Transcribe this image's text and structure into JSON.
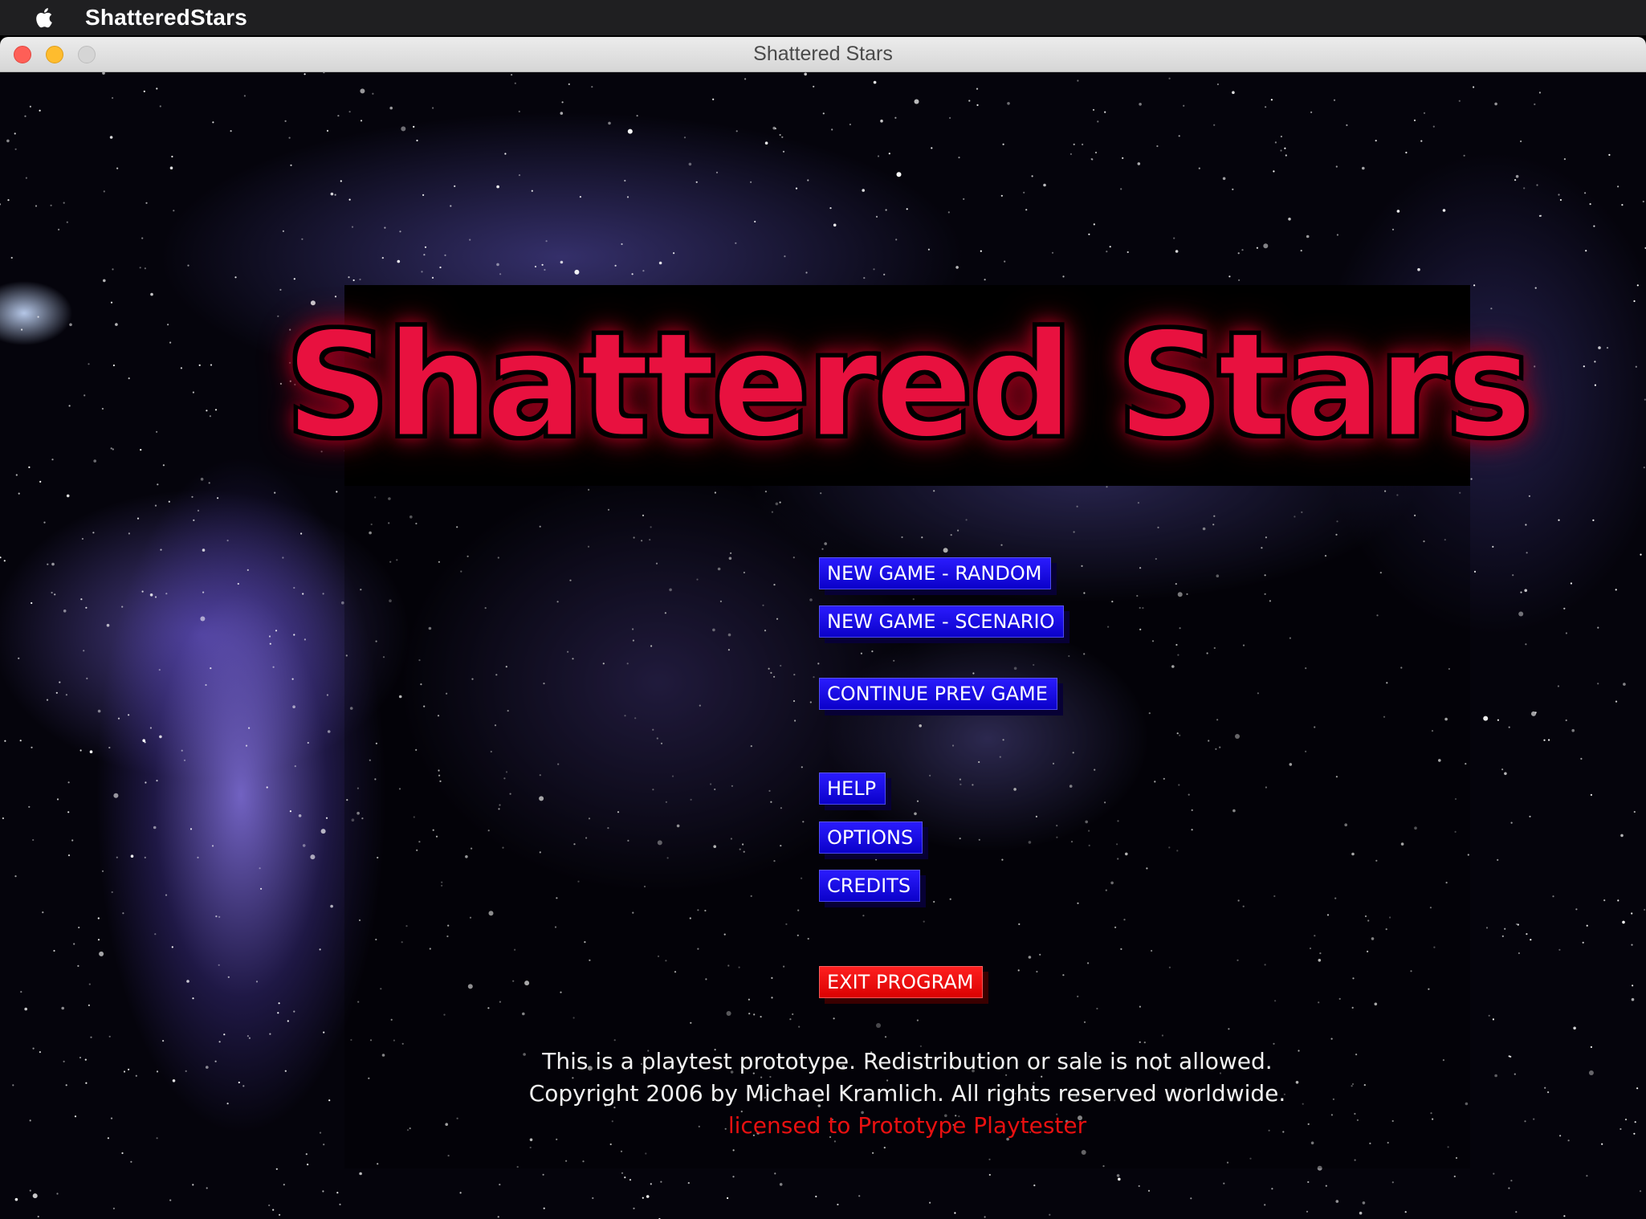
{
  "menubar": {
    "app_name": "ShatteredStars",
    "apple_icon": "apple-logo-icon"
  },
  "window": {
    "title": "Shattered Stars",
    "controls": [
      "close",
      "minimize",
      "zoom"
    ]
  },
  "game": {
    "logo_text": "Shattered Stars",
    "menu": {
      "new_random": "NEW GAME - RANDOM",
      "new_scenario": "NEW GAME - SCENARIO",
      "continue": "CONTINUE PREV GAME",
      "help": "HELP",
      "options": "OPTIONS",
      "credits": "CREDITS",
      "exit": "EXIT PROGRAM"
    },
    "footer": {
      "line1": "This is a playtest prototype. Redistribution or sale is not allowed.",
      "line2": "Copyright 2006 by Michael Kramlich. All rights reserved worldwide.",
      "line3": "licensed to Prototype Playtester"
    }
  },
  "colors": {
    "menu_button": "#1208e6",
    "exit_button": "#f00000",
    "logo_red": "#e8113f",
    "license_red": "#e81010"
  }
}
